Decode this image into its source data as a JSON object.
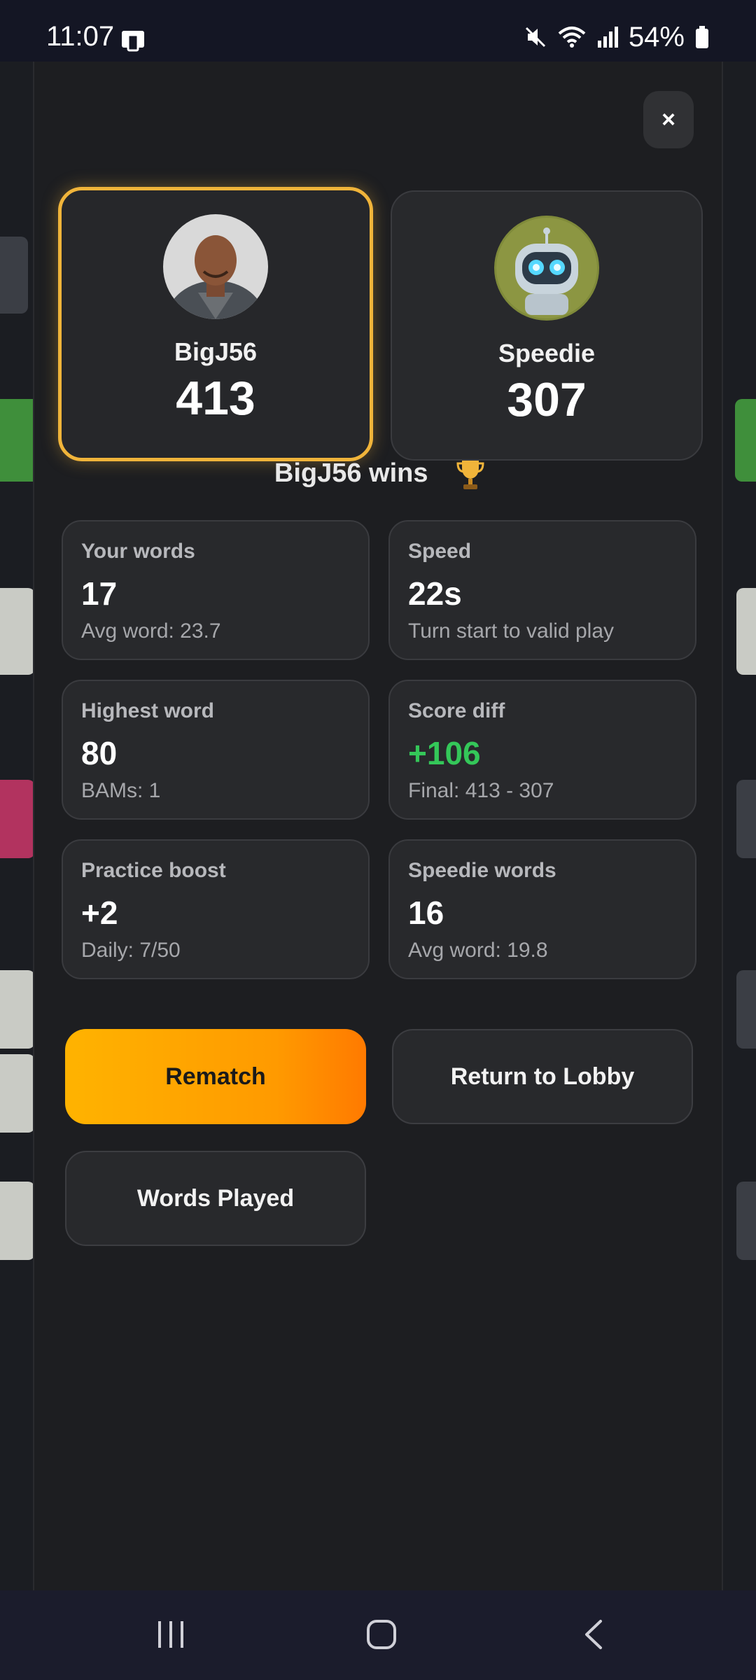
{
  "status_bar": {
    "time": "11:07",
    "battery": "54%"
  },
  "modal": {
    "close_label": "×",
    "players": [
      {
        "name": "BigJ56",
        "score": "413",
        "winner": true
      },
      {
        "name": "Speedie",
        "score": "307",
        "winner": false
      }
    ],
    "result_text": "BigJ56 wins",
    "stats": [
      {
        "label": "Your words",
        "value": "17",
        "sub": "Avg word: 23.7"
      },
      {
        "label": "Speed",
        "value": "22s",
        "sub": "Turn start to valid play"
      },
      {
        "label": "Highest word",
        "value": "80",
        "sub": "BAMs: 1"
      },
      {
        "label": "Score diff",
        "value": "+106",
        "sub": "Final: 413 - 307"
      },
      {
        "label": "Practice boost",
        "value": "+2",
        "sub": "Daily: 7/50"
      },
      {
        "label": "Speedie words",
        "value": "16",
        "sub": "Avg word: 19.8"
      }
    ],
    "buttons": {
      "rematch": "Rematch",
      "return_lobby": "Return to Lobby",
      "words_played": "Words Played"
    }
  },
  "colors": {
    "accent_orange": "#ffa500",
    "winner_border": "#f0b43a",
    "positive_green": "#34c759",
    "modal_bg": "#1d1e21"
  },
  "icons": [
    "mute-icon",
    "wifi-icon",
    "signal-icon",
    "battery-icon",
    "close-icon",
    "trophy-icon",
    "recents-icon",
    "home-icon",
    "back-icon"
  ]
}
